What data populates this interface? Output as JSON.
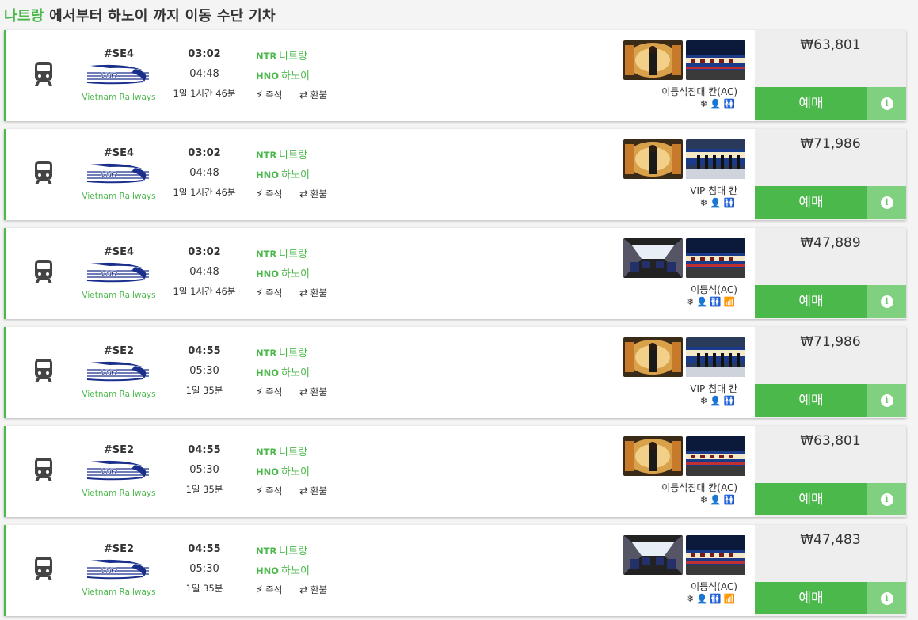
{
  "header": {
    "from": "나트랑",
    "rest": " 에서부터 하노이 까지 이동 수단 기차"
  },
  "labels": {
    "instant": "즉석",
    "refund": "환불",
    "book": "예매",
    "operator": "Vietnam Railways",
    "dep_code": "NTR",
    "dep_name": "나트랑",
    "arr_code": "HNO",
    "arr_name": "하노이"
  },
  "results": [
    {
      "train": "#SE4",
      "dep": "03:02",
      "arr": "04:48",
      "duration": "1일 1시간 46분",
      "seat": "이등석침대 칸(AC)",
      "price": "₩63,801",
      "amenities": [
        "snowflake-icon",
        "person-icon",
        "restroom-icon"
      ],
      "photos": [
        "sleeper",
        "exterior"
      ]
    },
    {
      "train": "#SE4",
      "dep": "03:02",
      "arr": "04:48",
      "duration": "1일 1시간 46분",
      "seat": "VIP 침대 칸",
      "price": "₩71,986",
      "amenities": [
        "snowflake-icon",
        "person-icon",
        "restroom-icon"
      ],
      "photos": [
        "sleeper",
        "vip-exterior"
      ]
    },
    {
      "train": "#SE4",
      "dep": "03:02",
      "arr": "04:48",
      "duration": "1일 1시간 46분",
      "seat": "이등석(AC)",
      "price": "₩47,889",
      "amenities": [
        "snowflake-icon",
        "person-icon",
        "restroom-icon",
        "wifi-icon"
      ],
      "photos": [
        "seat",
        "exterior"
      ]
    },
    {
      "train": "#SE2",
      "dep": "04:55",
      "arr": "05:30",
      "duration": "1일 35분",
      "seat": "VIP 침대 칸",
      "price": "₩71,986",
      "amenities": [
        "snowflake-icon",
        "person-icon",
        "restroom-icon"
      ],
      "photos": [
        "sleeper",
        "vip-exterior"
      ]
    },
    {
      "train": "#SE2",
      "dep": "04:55",
      "arr": "05:30",
      "duration": "1일 35분",
      "seat": "이등석침대 칸(AC)",
      "price": "₩63,801",
      "amenities": [
        "snowflake-icon",
        "person-icon",
        "restroom-icon"
      ],
      "photos": [
        "sleeper",
        "exterior"
      ]
    },
    {
      "train": "#SE2",
      "dep": "04:55",
      "arr": "05:30",
      "duration": "1일 35분",
      "seat": "이등석(AC)",
      "price": "₩47,483",
      "amenities": [
        "snowflake-icon",
        "person-icon",
        "restroom-icon",
        "wifi-icon"
      ],
      "photos": [
        "seat",
        "exterior"
      ]
    }
  ],
  "colors": {
    "accent": "#4bb84b",
    "info": "#7fd07f",
    "price_bg": "#eeeeee"
  }
}
